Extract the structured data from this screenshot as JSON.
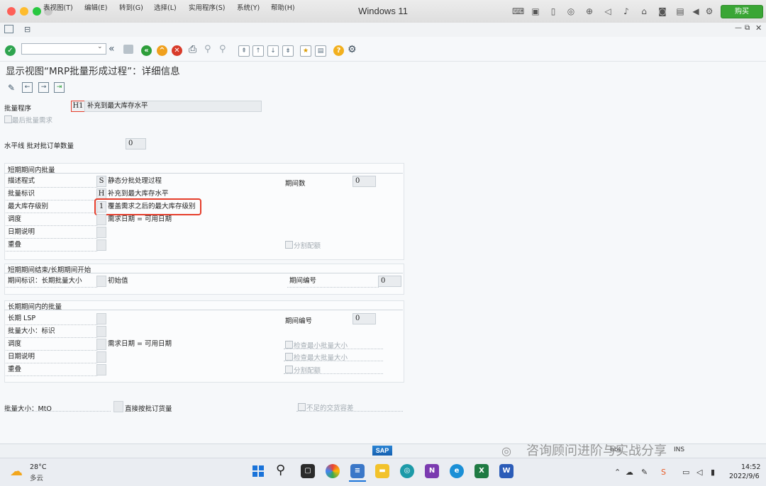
{
  "window": {
    "title": "Windows 11",
    "buy_label": "购买"
  },
  "menu": {
    "items": [
      "表视图(T)",
      "编辑(E)",
      "转到(G)",
      "选择(L)",
      "实用程序(S)",
      "系统(Y)",
      "帮助(H)"
    ]
  },
  "page": {
    "title": "显示视图“MRP批量形成过程”：详细信息"
  },
  "form": {
    "lot_procedure_label": "批量程序",
    "lot_procedure_value": "H1",
    "lot_procedure_desc": "补充到最大库存水平",
    "last_lot_req_label": "最后批量需求",
    "horizon_label": "水平线 批对批订单数量",
    "horizon_value": "0",
    "short": {
      "header": "短期期间内批量",
      "desc_label": "描述程式",
      "desc_code": "S",
      "desc_value": "静态分批处理过程",
      "ind_label": "批量标识",
      "ind_code": "H",
      "ind_value": "补充到最大库存水平",
      "maxlvl_label": "最大库存级别",
      "maxlvl_code": "1",
      "maxlvl_value": "覆盖需求之后的最大库存级别",
      "sched_label": "调度",
      "sched_value": "需求日期 = 可用日期",
      "date_label": "日期说明",
      "overlap_label": "重叠",
      "periods_label": "期间数",
      "periods_value": "0",
      "split_label": "分割配额"
    },
    "mid": {
      "header": "短期期间结束/长期期间开始",
      "period_ind_label": "期间标识：长期批量大小",
      "period_ind_value": "初始值",
      "period_no_label": "期间编号",
      "period_no_value": "0"
    },
    "long": {
      "header": "长期期间内的批量",
      "lsp_label": "长期 LSP",
      "lotsize_label": "批量大小：标识",
      "sched_label": "调度",
      "sched_value": "需求日期 = 可用日期",
      "date_label": "日期说明",
      "overlap_label": "重叠",
      "period_no_label": "期间编号",
      "period_no_value": "0",
      "check_min_label": "检查最小批量大小",
      "check_max_label": "检查最大批量大小",
      "split_label": "分割配额"
    },
    "mto_label": "批量大小：MtO",
    "direct_label": "直接按批订货量",
    "shortfall_label": "不足的交货容差"
  },
  "status": {
    "sap_logo": "SAP",
    "field1": "bbs",
    "field2": "INS",
    "watermark": "咨询顾问进阶与实战分享"
  },
  "taskbar": {
    "weather_temp": "28°C",
    "weather_desc": "多云",
    "time": "14:52",
    "date": "2022/9/6"
  },
  "colors": {
    "highlight": "#e53d2b",
    "ok_green": "#2ea44f",
    "back_green": "#2e9e3a",
    "exit_orange": "#f0a01e",
    "cancel_red": "#d83b2a",
    "help_yellow": "#f2b01e"
  }
}
